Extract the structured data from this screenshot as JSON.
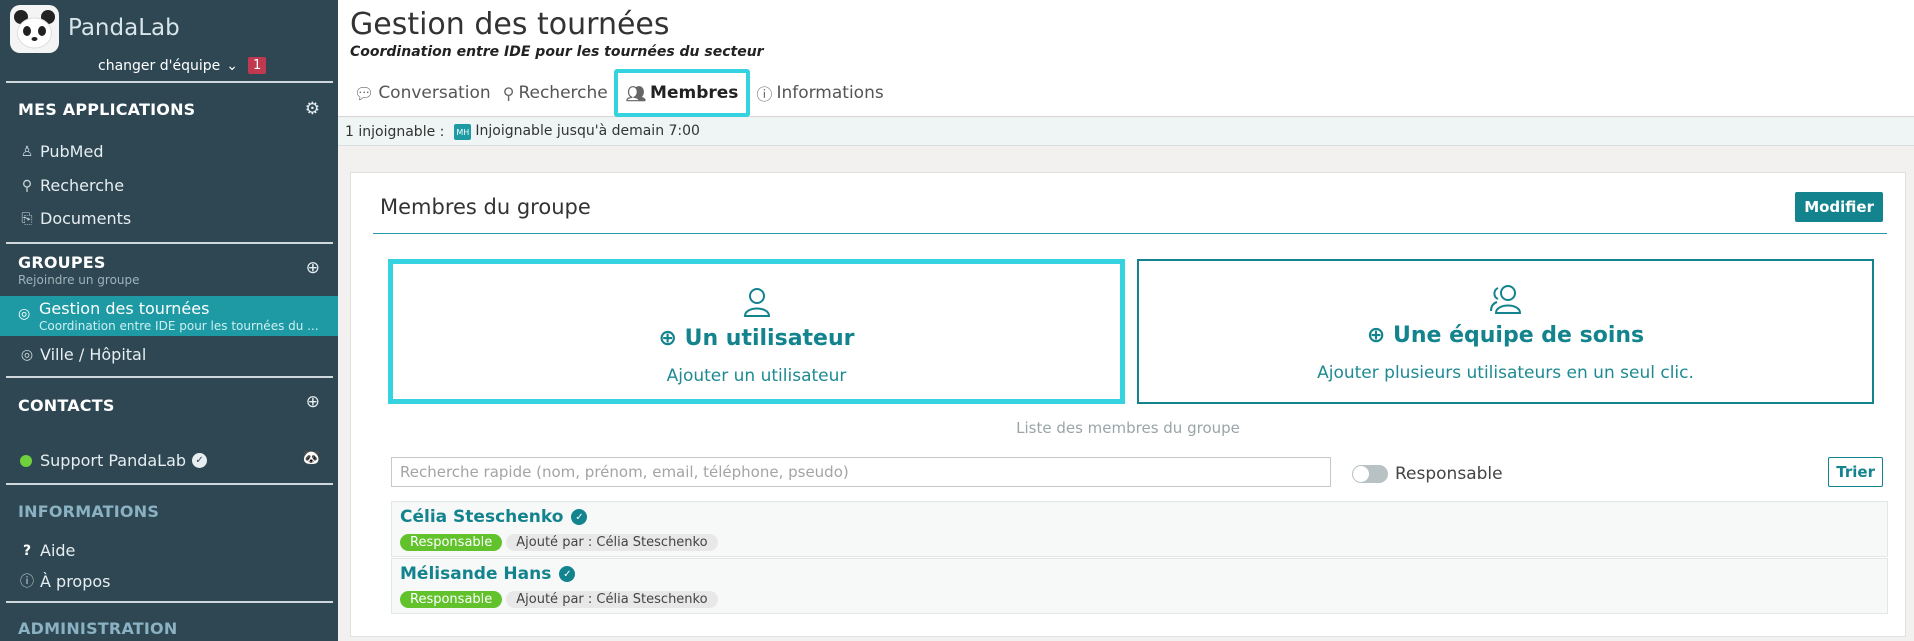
{
  "sidebar": {
    "app_name": "PandaLab",
    "team_switch_label": "changer d'équipe",
    "team_badge": "1",
    "applications": {
      "title": "MES APPLICATIONS",
      "items": [
        {
          "label": "PubMed",
          "icon": "person-icon"
        },
        {
          "label": "Recherche",
          "icon": "search-icon"
        },
        {
          "label": "Documents",
          "icon": "paperclip-icon"
        }
      ]
    },
    "groups": {
      "title": "GROUPES",
      "subtitle": "Rejoindre un groupe",
      "active": {
        "label": "Gestion des tournées",
        "sub": "Coordination entre IDE pour les tournées du ..."
      },
      "items": [
        {
          "label": "Ville / Hôpital"
        }
      ]
    },
    "contacts": {
      "title": "CONTACTS",
      "items": [
        {
          "label": "Support PandaLab"
        }
      ]
    },
    "informations": {
      "title": "INFORMATIONS",
      "items": [
        {
          "label": "Aide",
          "icon": "?"
        },
        {
          "label": "À propos",
          "icon": "ⓘ"
        }
      ]
    },
    "administration": {
      "title": "ADMINISTRATION"
    }
  },
  "header": {
    "title": "Gestion des tournées",
    "subtitle": "Coordination entre IDE pour les tournées du secteur",
    "tabs": [
      {
        "label": "Conversation",
        "active": false
      },
      {
        "label": "Recherche",
        "active": false
      },
      {
        "label": "Membres",
        "active": true
      },
      {
        "label": "Informations",
        "active": false
      }
    ]
  },
  "status": {
    "count_label": "1 injoignable :",
    "initials": "MH",
    "text": "Injoignable jusqu'à demain 7:00"
  },
  "members_panel": {
    "title": "Membres du groupe",
    "modify_label": "Modifier",
    "add_user": {
      "title": "Un utilisateur",
      "desc": "Ajouter un utilisateur"
    },
    "add_team": {
      "title": "Une équipe de soins",
      "desc": "Ajouter plusieurs utilisateurs en un seul clic."
    },
    "list_caption": "Liste des membres du groupe",
    "search_placeholder": "Recherche rapide (nom, prénom, email, téléphone, pseudo)",
    "toggle_label": "Responsable",
    "sort_label": "Trier",
    "members": [
      {
        "name": "Célia Steschenko",
        "role": "Responsable",
        "added_by": "Ajouté par : Célia Steschenko"
      },
      {
        "name": "Mélisande Hans",
        "role": "Responsable",
        "added_by": "Ajouté par : Célia Steschenko"
      }
    ]
  },
  "colors": {
    "sidebar_bg": "#2e4752",
    "accent": "#13838d",
    "active_item": "#1e9aa5",
    "focus": "#35d2df",
    "badge": "#61c22b"
  }
}
